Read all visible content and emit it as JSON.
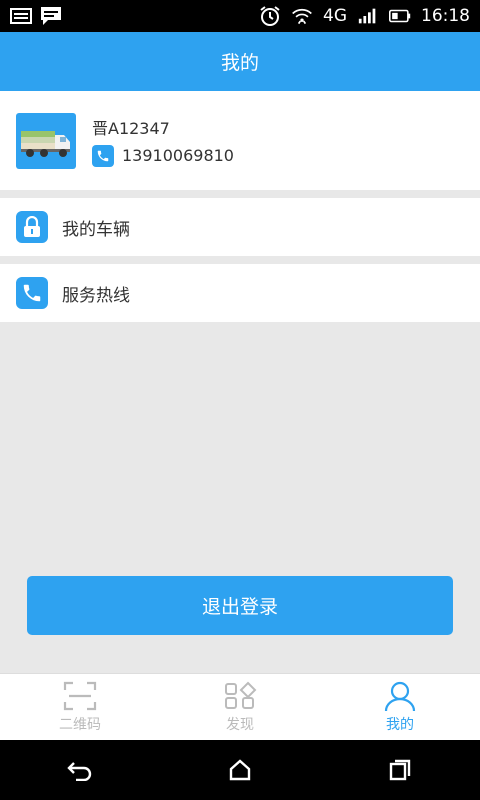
{
  "status_bar": {
    "time": "16:18",
    "network": "4G",
    "icons": [
      "gallery-icon",
      "message-icon",
      "alarm-icon",
      "wifi-icon",
      "network-4g-icon",
      "signal-icon",
      "battery-icon"
    ]
  },
  "header": {
    "title": "我的"
  },
  "profile": {
    "plate": "晋A12347",
    "phone": "13910069810",
    "avatar_icon": "truck-icon"
  },
  "menu": {
    "vehicle_label": "我的车辆",
    "hotline_label": "服务热线"
  },
  "logout": {
    "label": "退出登录"
  },
  "tabs": [
    {
      "label": "二维码",
      "icon": "qr-scan-icon"
    },
    {
      "label": "发现",
      "icon": "discover-icon"
    },
    {
      "label": "我的",
      "icon": "profile-icon"
    }
  ],
  "colors": {
    "accent": "#2ea2f0",
    "background": "#e8e8e8"
  }
}
